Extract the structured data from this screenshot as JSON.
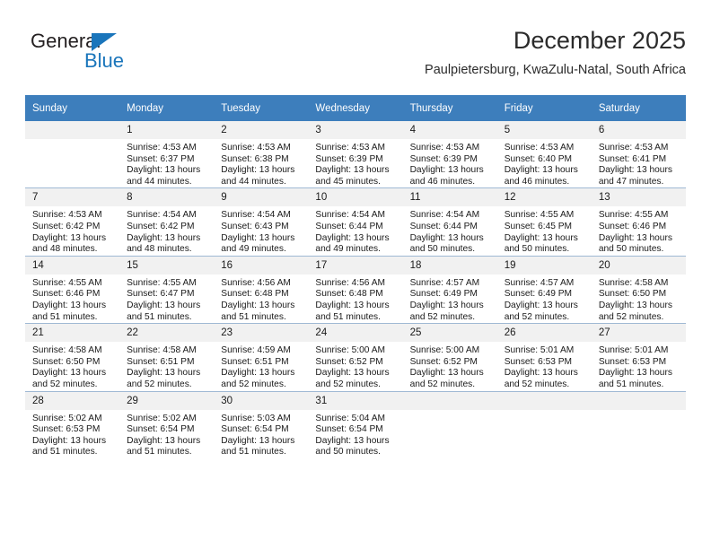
{
  "logo": {
    "word_top": "General",
    "word_bottom": "Blue",
    "triangle_color": "#1a75bb"
  },
  "header": {
    "title": "December 2025",
    "subtitle": "Paulpietersburg, KwaZulu-Natal, South Africa"
  },
  "colors": {
    "header_blue": "#3d7ebc",
    "daynum_band": "#f1f1f1",
    "grid_line": "#9fb9d4",
    "logo_blue": "#1a75bb"
  },
  "weekdays": [
    "Sunday",
    "Monday",
    "Tuesday",
    "Wednesday",
    "Thursday",
    "Friday",
    "Saturday"
  ],
  "weeks": [
    [
      {
        "day": "",
        "blank": true,
        "sunrise": "",
        "sunset": "",
        "daylight1": "",
        "daylight2": ""
      },
      {
        "day": "1",
        "sunrise": "Sunrise: 4:53 AM",
        "sunset": "Sunset: 6:37 PM",
        "daylight1": "Daylight: 13 hours",
        "daylight2": "and 44 minutes."
      },
      {
        "day": "2",
        "sunrise": "Sunrise: 4:53 AM",
        "sunset": "Sunset: 6:38 PM",
        "daylight1": "Daylight: 13 hours",
        "daylight2": "and 44 minutes."
      },
      {
        "day": "3",
        "sunrise": "Sunrise: 4:53 AM",
        "sunset": "Sunset: 6:39 PM",
        "daylight1": "Daylight: 13 hours",
        "daylight2": "and 45 minutes."
      },
      {
        "day": "4",
        "sunrise": "Sunrise: 4:53 AM",
        "sunset": "Sunset: 6:39 PM",
        "daylight1": "Daylight: 13 hours",
        "daylight2": "and 46 minutes."
      },
      {
        "day": "5",
        "sunrise": "Sunrise: 4:53 AM",
        "sunset": "Sunset: 6:40 PM",
        "daylight1": "Daylight: 13 hours",
        "daylight2": "and 46 minutes."
      },
      {
        "day": "6",
        "sunrise": "Sunrise: 4:53 AM",
        "sunset": "Sunset: 6:41 PM",
        "daylight1": "Daylight: 13 hours",
        "daylight2": "and 47 minutes."
      }
    ],
    [
      {
        "day": "7",
        "sunrise": "Sunrise: 4:53 AM",
        "sunset": "Sunset: 6:42 PM",
        "daylight1": "Daylight: 13 hours",
        "daylight2": "and 48 minutes."
      },
      {
        "day": "8",
        "sunrise": "Sunrise: 4:54 AM",
        "sunset": "Sunset: 6:42 PM",
        "daylight1": "Daylight: 13 hours",
        "daylight2": "and 48 minutes."
      },
      {
        "day": "9",
        "sunrise": "Sunrise: 4:54 AM",
        "sunset": "Sunset: 6:43 PM",
        "daylight1": "Daylight: 13 hours",
        "daylight2": "and 49 minutes."
      },
      {
        "day": "10",
        "sunrise": "Sunrise: 4:54 AM",
        "sunset": "Sunset: 6:44 PM",
        "daylight1": "Daylight: 13 hours",
        "daylight2": "and 49 minutes."
      },
      {
        "day": "11",
        "sunrise": "Sunrise: 4:54 AM",
        "sunset": "Sunset: 6:44 PM",
        "daylight1": "Daylight: 13 hours",
        "daylight2": "and 50 minutes."
      },
      {
        "day": "12",
        "sunrise": "Sunrise: 4:55 AM",
        "sunset": "Sunset: 6:45 PM",
        "daylight1": "Daylight: 13 hours",
        "daylight2": "and 50 minutes."
      },
      {
        "day": "13",
        "sunrise": "Sunrise: 4:55 AM",
        "sunset": "Sunset: 6:46 PM",
        "daylight1": "Daylight: 13 hours",
        "daylight2": "and 50 minutes."
      }
    ],
    [
      {
        "day": "14",
        "sunrise": "Sunrise: 4:55 AM",
        "sunset": "Sunset: 6:46 PM",
        "daylight1": "Daylight: 13 hours",
        "daylight2": "and 51 minutes."
      },
      {
        "day": "15",
        "sunrise": "Sunrise: 4:55 AM",
        "sunset": "Sunset: 6:47 PM",
        "daylight1": "Daylight: 13 hours",
        "daylight2": "and 51 minutes."
      },
      {
        "day": "16",
        "sunrise": "Sunrise: 4:56 AM",
        "sunset": "Sunset: 6:48 PM",
        "daylight1": "Daylight: 13 hours",
        "daylight2": "and 51 minutes."
      },
      {
        "day": "17",
        "sunrise": "Sunrise: 4:56 AM",
        "sunset": "Sunset: 6:48 PM",
        "daylight1": "Daylight: 13 hours",
        "daylight2": "and 51 minutes."
      },
      {
        "day": "18",
        "sunrise": "Sunrise: 4:57 AM",
        "sunset": "Sunset: 6:49 PM",
        "daylight1": "Daylight: 13 hours",
        "daylight2": "and 52 minutes."
      },
      {
        "day": "19",
        "sunrise": "Sunrise: 4:57 AM",
        "sunset": "Sunset: 6:49 PM",
        "daylight1": "Daylight: 13 hours",
        "daylight2": "and 52 minutes."
      },
      {
        "day": "20",
        "sunrise": "Sunrise: 4:58 AM",
        "sunset": "Sunset: 6:50 PM",
        "daylight1": "Daylight: 13 hours",
        "daylight2": "and 52 minutes."
      }
    ],
    [
      {
        "day": "21",
        "sunrise": "Sunrise: 4:58 AM",
        "sunset": "Sunset: 6:50 PM",
        "daylight1": "Daylight: 13 hours",
        "daylight2": "and 52 minutes."
      },
      {
        "day": "22",
        "sunrise": "Sunrise: 4:58 AM",
        "sunset": "Sunset: 6:51 PM",
        "daylight1": "Daylight: 13 hours",
        "daylight2": "and 52 minutes."
      },
      {
        "day": "23",
        "sunrise": "Sunrise: 4:59 AM",
        "sunset": "Sunset: 6:51 PM",
        "daylight1": "Daylight: 13 hours",
        "daylight2": "and 52 minutes."
      },
      {
        "day": "24",
        "sunrise": "Sunrise: 5:00 AM",
        "sunset": "Sunset: 6:52 PM",
        "daylight1": "Daylight: 13 hours",
        "daylight2": "and 52 minutes."
      },
      {
        "day": "25",
        "sunrise": "Sunrise: 5:00 AM",
        "sunset": "Sunset: 6:52 PM",
        "daylight1": "Daylight: 13 hours",
        "daylight2": "and 52 minutes."
      },
      {
        "day": "26",
        "sunrise": "Sunrise: 5:01 AM",
        "sunset": "Sunset: 6:53 PM",
        "daylight1": "Daylight: 13 hours",
        "daylight2": "and 52 minutes."
      },
      {
        "day": "27",
        "sunrise": "Sunrise: 5:01 AM",
        "sunset": "Sunset: 6:53 PM",
        "daylight1": "Daylight: 13 hours",
        "daylight2": "and 51 minutes."
      }
    ],
    [
      {
        "day": "28",
        "sunrise": "Sunrise: 5:02 AM",
        "sunset": "Sunset: 6:53 PM",
        "daylight1": "Daylight: 13 hours",
        "daylight2": "and 51 minutes."
      },
      {
        "day": "29",
        "sunrise": "Sunrise: 5:02 AM",
        "sunset": "Sunset: 6:54 PM",
        "daylight1": "Daylight: 13 hours",
        "daylight2": "and 51 minutes."
      },
      {
        "day": "30",
        "sunrise": "Sunrise: 5:03 AM",
        "sunset": "Sunset: 6:54 PM",
        "daylight1": "Daylight: 13 hours",
        "daylight2": "and 51 minutes."
      },
      {
        "day": "31",
        "sunrise": "Sunrise: 5:04 AM",
        "sunset": "Sunset: 6:54 PM",
        "daylight1": "Daylight: 13 hours",
        "daylight2": "and 50 minutes."
      },
      {
        "day": "",
        "blank": true,
        "sunrise": "",
        "sunset": "",
        "daylight1": "",
        "daylight2": ""
      },
      {
        "day": "",
        "blank": true,
        "sunrise": "",
        "sunset": "",
        "daylight1": "",
        "daylight2": ""
      },
      {
        "day": "",
        "blank": true,
        "sunrise": "",
        "sunset": "",
        "daylight1": "",
        "daylight2": ""
      }
    ]
  ]
}
